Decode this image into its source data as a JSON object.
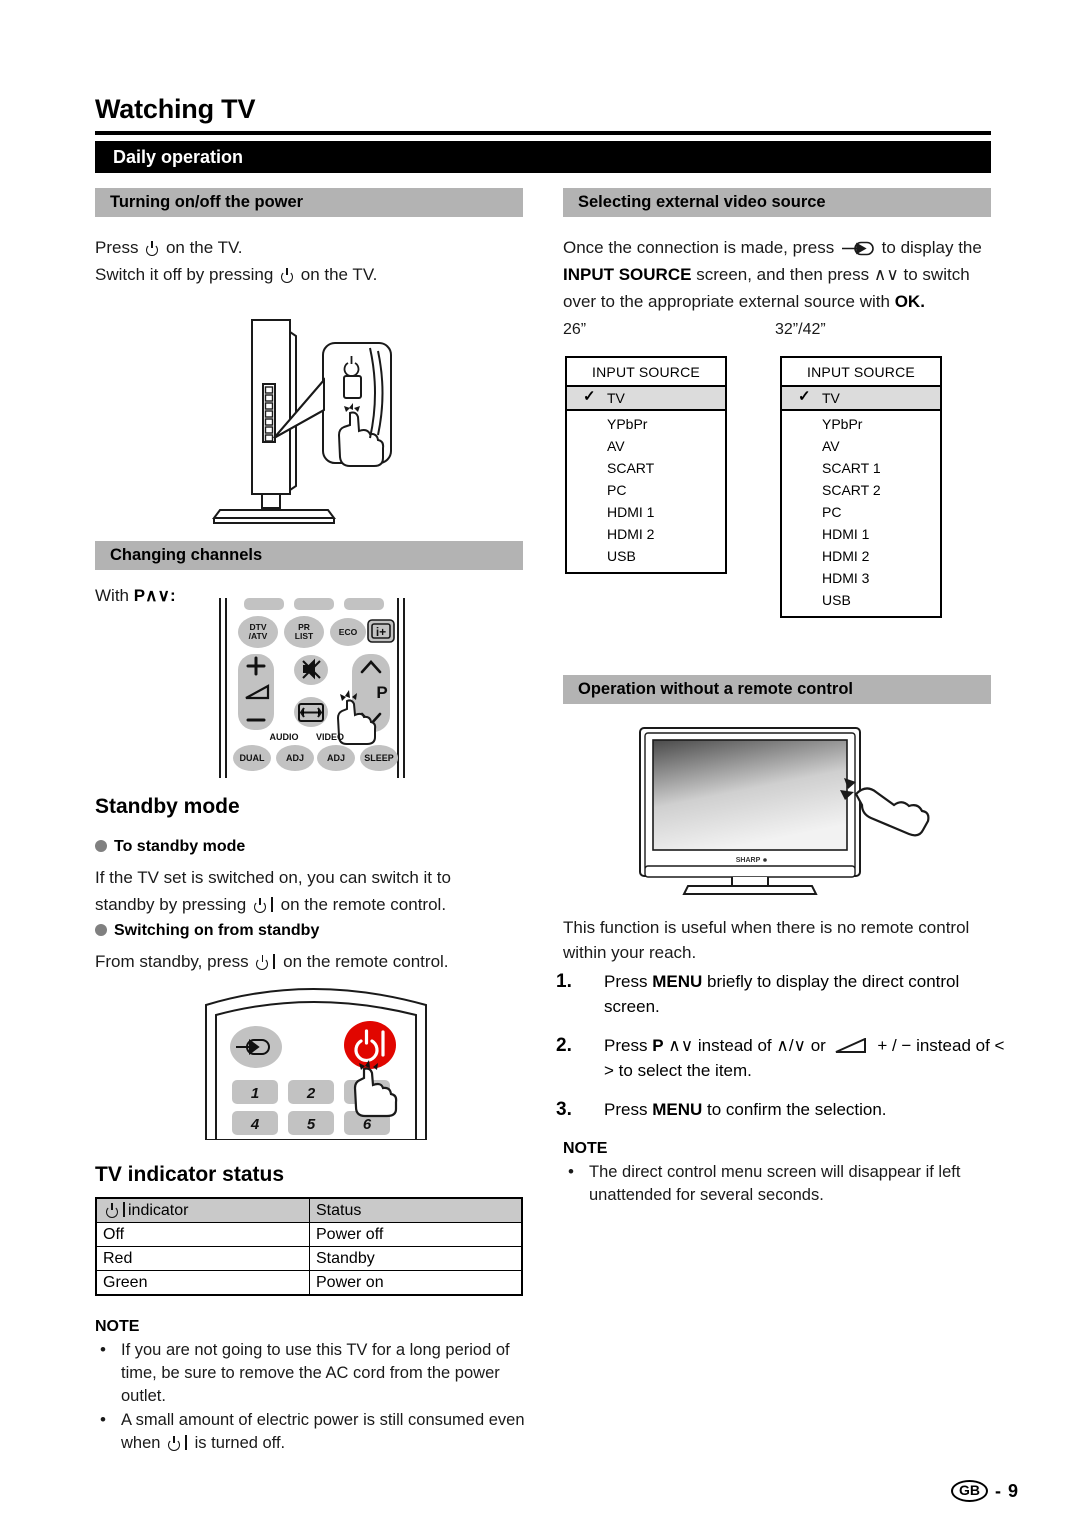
{
  "page": {
    "title": "Watching TV",
    "section_band": "Daily operation",
    "footer_region": "GB",
    "footer_dash": "-",
    "footer_page": "9"
  },
  "left_column": {
    "power": {
      "header": "Turning on/off the power",
      "line1_pre": "Press",
      "line1_post": "on the TV.",
      "line2_pre": "Switch it off by pressing",
      "line2_post": "on the TV."
    },
    "channels": {
      "header": "Changing channels",
      "with_label": "With",
      "with_keys": "P∧∨:"
    },
    "standby": {
      "heading": "Standby mode",
      "to_standby_label": "To standby mode",
      "to_standby_text_pre": "If the TV set is switched on, you can switch it to standby by pressing",
      "to_standby_text_post": "on the remote control.",
      "switching_label": "Switching on from standby",
      "switching_text_pre": "From standby, press",
      "switching_text_post": "on the remote control."
    },
    "indicator": {
      "heading": "TV indicator status",
      "columns": [
        "indicator",
        "Status"
      ],
      "rows": [
        [
          "Off",
          "Power off"
        ],
        [
          "Red",
          "Standby"
        ],
        [
          "Green",
          "Power on"
        ]
      ]
    },
    "note": {
      "title": "NOTE",
      "items": [
        "If you are not going to use this TV for a long period of time, be sure to remove the AC cord from the power outlet.",
        "A small amount of electric power is still consumed even when ⏻ | is turned off."
      ],
      "item2_pre": "A small amount of electric power is still consumed even when",
      "item2_post": "is turned off."
    },
    "remote_buttons": {
      "row_top": [
        "DTV\n/ATV",
        "PR\nLIST",
        "ECO",
        "i+"
      ],
      "labels": [
        "AUDIO",
        "VIDEO"
      ],
      "row_bottom": [
        "DUAL",
        "ADJ",
        "ADJ",
        "SLEEP"
      ],
      "p_label": "P",
      "plus": "+",
      "minus": "−"
    },
    "remote_numbers": [
      "1",
      "2",
      "",
      "4",
      "5",
      "6"
    ]
  },
  "right_column": {
    "source": {
      "header": "Selecting external video source",
      "text_part1": "Once the connection is made, press",
      "text_part2": "to display the",
      "text_bold1": "INPUT SOURCE",
      "text_part3": "screen, and then press",
      "text_keys": "∧∨",
      "text_part4": "to switch over to the appropriate external source with",
      "text_bold2": "OK."
    },
    "menus": [
      {
        "size_label": "26”",
        "title": "INPUT SOURCE",
        "selected": "TV",
        "items": [
          "YPbPr",
          "AV",
          "SCART",
          "PC",
          "HDMI 1",
          "HDMI 2",
          "USB"
        ]
      },
      {
        "size_label": "32”/42”",
        "title": "INPUT SOURCE",
        "selected": "TV",
        "items": [
          "YPbPr",
          "AV",
          "SCART 1",
          "SCART 2",
          "PC",
          "HDMI 1",
          "HDMI 2",
          "HDMI 3",
          "USB"
        ]
      }
    ],
    "no_remote": {
      "header": "Operation without a remote control",
      "intro": "This function is useful when there is no remote control within your reach.",
      "steps": [
        {
          "num": "1.",
          "pre": "Press",
          "bold": "MENU",
          "post": "briefly to display the direct control screen."
        },
        {
          "num": "2.",
          "pre": "Press",
          "bold": "P",
          "keys_up_down": "∧∨",
          "mid1": "instead of",
          "keys_slash": "∧/∨",
          "mid2": "or",
          "plus_minus": "+ / −",
          "mid3": "instead of",
          "keys_lr": "< >",
          "post": "to select the item."
        },
        {
          "num": "3.",
          "pre": "Press",
          "bold": "MENU",
          "post": "to confirm the selection."
        }
      ]
    },
    "note": {
      "title": "NOTE",
      "items": [
        "The direct control menu screen will disappear if left unattended for several seconds."
      ]
    },
    "tv_brand": "SHARP"
  }
}
